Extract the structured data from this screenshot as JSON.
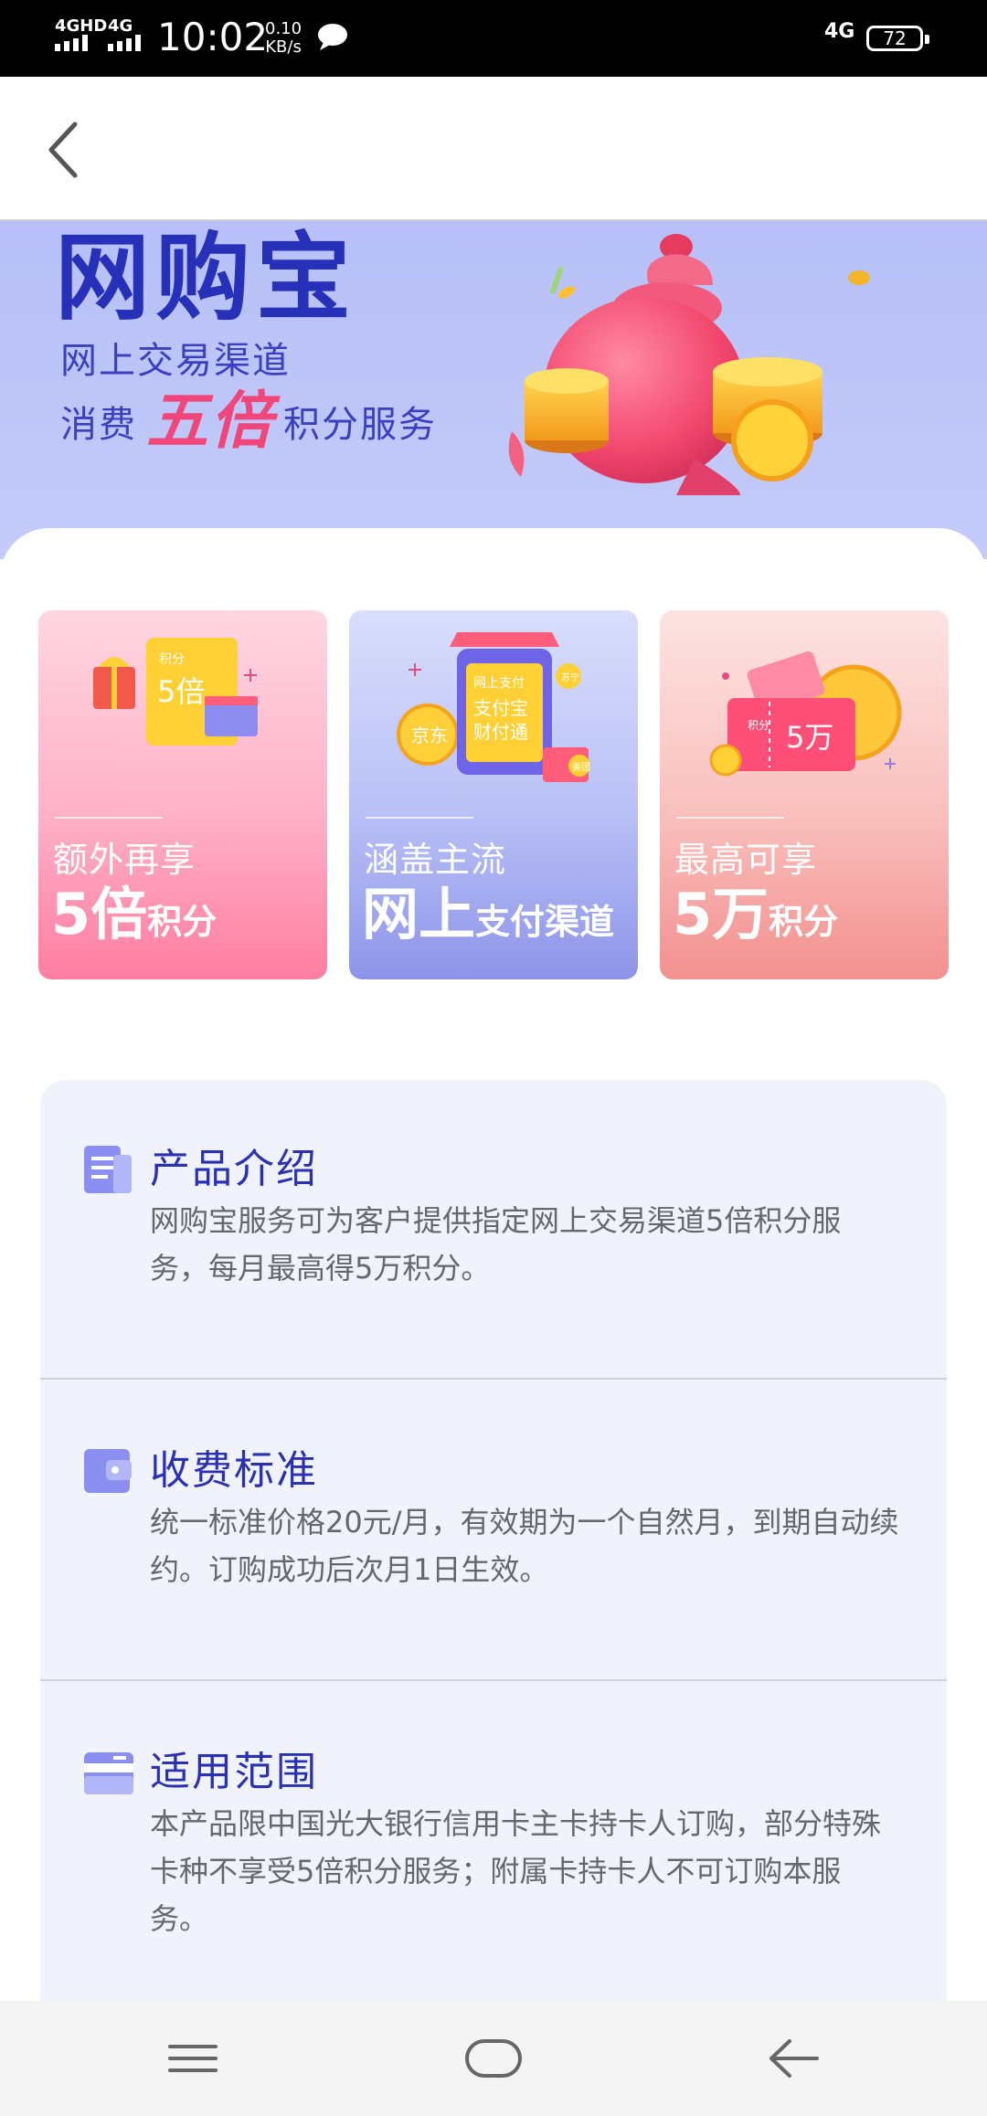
{
  "status_bar": {
    "signal1_label": "4GHD",
    "signal2_label": "4G",
    "time": "10:02",
    "speed_value": "0.10",
    "speed_unit": "KB/s",
    "network_right": "4G",
    "battery": "72"
  },
  "banner": {
    "title": "网购宝",
    "line1": "网上交易渠道",
    "line2_prefix": "消费",
    "line2_highlight": "五倍",
    "line2_suffix": "积分服务"
  },
  "cards": [
    {
      "art_label_top": "积分",
      "art_label_main": "5倍",
      "caption_line1": "额外再享",
      "caption_big": "5倍",
      "caption_small": "积分"
    },
    {
      "art_label_top": "网上支付",
      "art_label_main1": "支付宝",
      "art_label_main2": "财付通",
      "art_badge_left": "京东",
      "art_badge_right1": "苏宁",
      "art_badge_right2": "美团",
      "caption_line1": "涵盖主流",
      "caption_big": "网上",
      "caption_small": "支付渠道"
    },
    {
      "art_label_top": "积分",
      "art_label_main": "5万",
      "caption_line1": "最高可享",
      "caption_big": "5万",
      "caption_small": "积分"
    }
  ],
  "info": {
    "sections": [
      {
        "title": "产品介绍",
        "body": "网购宝服务可为客户提供指定网上交易渠道5倍积分服务，每月最高得5万积分。"
      },
      {
        "title": "收费标准",
        "body": "统一标准价格20元/月，有效期为一个自然月，到期自动续约。订购成功后次月1日生效。"
      },
      {
        "title": "适用范围",
        "body": "本产品限中国光大银行信用卡主卡持卡人订购，部分特殊卡种不享受5倍积分服务；附属卡持卡人不可订购本服务。"
      }
    ]
  },
  "colors": {
    "accent": "#2a31b0",
    "banner_bg": "#b7c0f7",
    "highlight_pink": "#f0467a"
  }
}
